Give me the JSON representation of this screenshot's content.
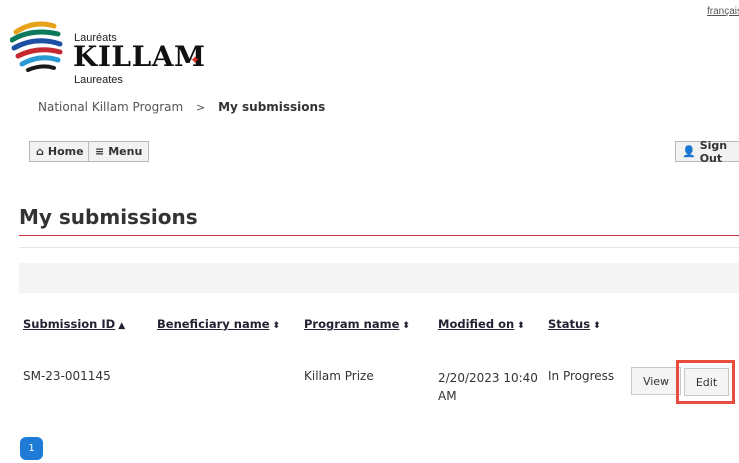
{
  "header": {
    "lang_link": "français",
    "logo": {
      "line_top": "Lauréats",
      "line_main": "KILLAM",
      "line_bottom": "Laureates"
    }
  },
  "breadcrumb": {
    "parent": "National Killam Program",
    "separator": ">",
    "current": "My submissions"
  },
  "nav": {
    "home_label": "Home",
    "menu_label": "Menu",
    "signout_label": "Sign Out"
  },
  "page": {
    "title": "My submissions"
  },
  "table": {
    "headers": [
      {
        "label": "Submission ID",
        "sort": "▲"
      },
      {
        "label": "Beneficiary name",
        "sort": "⬍"
      },
      {
        "label": "Program name",
        "sort": "⬍"
      },
      {
        "label": "Modified on",
        "sort": "⬍"
      },
      {
        "label": "Status",
        "sort": "⬍"
      }
    ],
    "rows": [
      {
        "submission_id": "SM-23-001145",
        "beneficiary_name": "",
        "program_name": "Killam Prize",
        "modified_on": "2/20/2023 10:40 AM",
        "status": "In Progress",
        "view_label": "View",
        "edit_label": "Edit"
      }
    ]
  },
  "pagination": {
    "current_page": "1"
  },
  "colors": {
    "accent_rule": "#c8303a",
    "highlight": "#e74c3c",
    "pager": "#1e7bd6",
    "leaf": "#d52b1e"
  }
}
